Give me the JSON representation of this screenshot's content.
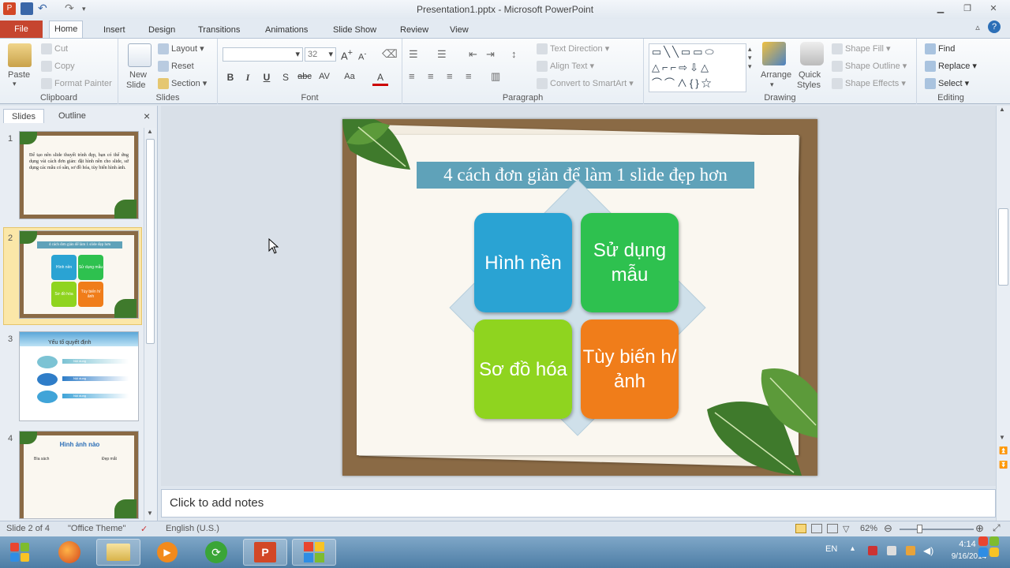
{
  "window": {
    "title": "Presentation1.pptx - Microsoft PowerPoint"
  },
  "tabs": [
    "File",
    "Home",
    "Insert",
    "Design",
    "Transitions",
    "Animations",
    "Slide Show",
    "Review",
    "View"
  ],
  "ribbon": {
    "clipboard": {
      "paste": "Paste",
      "cut": "Cut",
      "copy": "Copy",
      "format_painter": "Format Painter",
      "label": "Clipboard"
    },
    "slides": {
      "new_slide_1": "New",
      "new_slide_2": "Slide",
      "layout": "Layout",
      "reset": "Reset",
      "section": "Section",
      "label": "Slides"
    },
    "font": {
      "size": "32",
      "label": "Font",
      "bold": "B",
      "italic": "I",
      "underline": "U",
      "strike": "S",
      "shadow": "abc",
      "spacing": "AV",
      "case": "Aa",
      "color": "A"
    },
    "paragraph": {
      "text_direction": "Text Direction",
      "align_text": "Align Text",
      "convert_smartart": "Convert to SmartArt",
      "label": "Paragraph"
    },
    "drawing": {
      "arrange": "Arrange",
      "quick_styles_1": "Quick",
      "quick_styles_2": "Styles",
      "shape_fill": "Shape Fill",
      "shape_outline": "Shape Outline",
      "shape_effects": "Shape Effects",
      "label": "Drawing"
    },
    "editing": {
      "find": "Find",
      "replace": "Replace",
      "select": "Select",
      "label": "Editing"
    }
  },
  "pane": {
    "tab_slides": "Slides",
    "tab_outline": "Outline",
    "close": "×",
    "thumbs": [
      {
        "num": "1",
        "text": "Để tạo nên slide thuyết trình đẹp, bạn có thể ứng dụng vài cách đơn giản: đặt hình nền cho slide, sử dụng các mẫu có sẵn, sơ đồ hóa, tùy biến hình ảnh."
      },
      {
        "num": "2",
        "title": "4 cách đơn giản để làm 1 slide đẹp hơn",
        "boxes": [
          "Hình nền",
          "Sử dụng mẫu",
          "Sơ đồ hóa",
          "Tùy biến h/ảnh"
        ]
      },
      {
        "num": "3",
        "title": "Yếu tố quyết định",
        "rows": [
          "Nội dung",
          "Nội dung",
          "Nội dung"
        ]
      },
      {
        "num": "4",
        "title": "Hình ảnh nào",
        "col1": "Bìa sách",
        "col2": "Đẹp mắt"
      }
    ]
  },
  "slide": {
    "title": "4 cách đơn giản để làm 1 slide đẹp hơn",
    "boxes": [
      {
        "text": "Hình nền",
        "color": "#2aa3d3"
      },
      {
        "text": "Sử dụng mẫu",
        "color": "#2ec14f"
      },
      {
        "text": "Sơ đồ hóa",
        "color": "#8fd41f"
      },
      {
        "text": "Tùy biến h/ảnh",
        "color": "#f07d1a"
      }
    ]
  },
  "notes": {
    "placeholder": "Click to add notes"
  },
  "status": {
    "slide": "Slide 2 of 4",
    "theme": "\"Office Theme\"",
    "language": "English (U.S.)",
    "zoom": "62%"
  },
  "taskbar": {
    "lang": "EN",
    "time": "4:14",
    "date": "9/16/2014"
  }
}
